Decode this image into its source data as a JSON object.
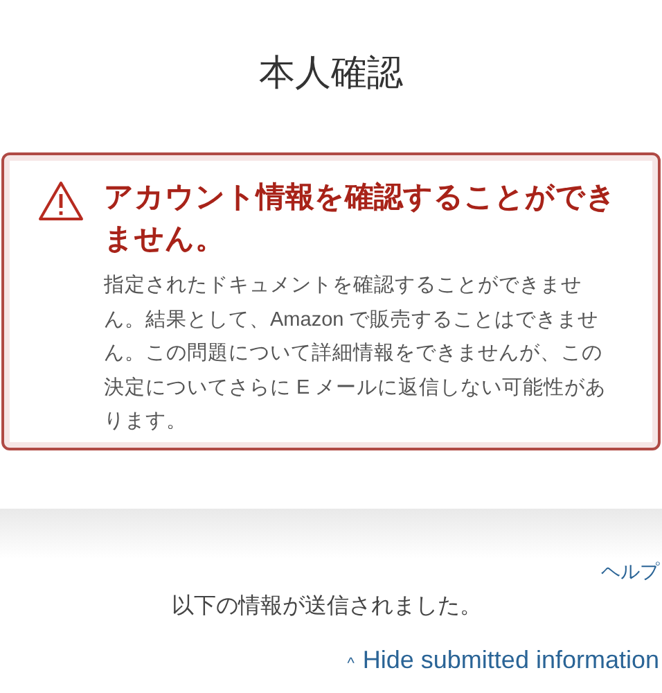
{
  "page_title": "本人確認",
  "alert": {
    "kind": "error",
    "heading": "アカウント情報を確認することができません。",
    "body": "指定されたドキュメントを確認することができません。結果として、Amazon で販売することはできません。この問題について詳細情報をできませんが、この決定についてさらに E メールに返信しない可能性があります。"
  },
  "help_link": "ヘルプ",
  "submitted_note": "以下の情報が送信されました。",
  "toggle": {
    "caret": "^",
    "label": "Hide submitted information"
  }
}
